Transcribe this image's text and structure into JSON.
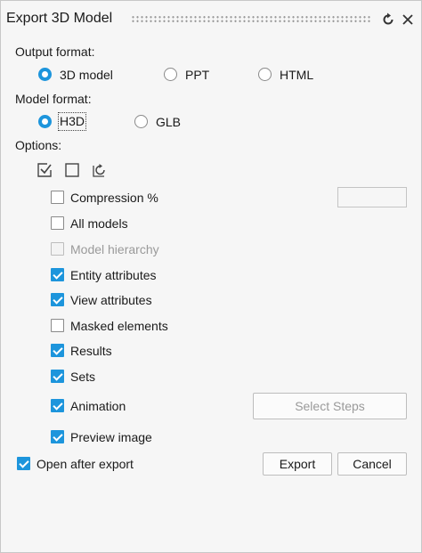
{
  "dialog": {
    "title": "Export 3D Model"
  },
  "output_format": {
    "label": "Output format:",
    "options": [
      {
        "label": "3D model",
        "selected": true
      },
      {
        "label": "PPT",
        "selected": false
      },
      {
        "label": "HTML",
        "selected": false
      }
    ]
  },
  "model_format": {
    "label": "Model format:",
    "options": [
      {
        "label": "H3D",
        "selected": true
      },
      {
        "label": "GLB",
        "selected": false
      }
    ]
  },
  "options": {
    "label": "Options:",
    "compression": {
      "label": "Compression %",
      "checked": false,
      "value": ""
    },
    "all_models": {
      "label": "All models",
      "checked": false
    },
    "model_hierarchy": {
      "label": "Model hierarchy",
      "checked": false,
      "disabled": true
    },
    "entity_attributes": {
      "label": "Entity attributes",
      "checked": true
    },
    "view_attributes": {
      "label": "View attributes",
      "checked": true
    },
    "masked_elements": {
      "label": "Masked elements",
      "checked": false
    },
    "results": {
      "label": "Results",
      "checked": true
    },
    "sets": {
      "label": "Sets",
      "checked": true
    },
    "animation": {
      "label": "Animation",
      "checked": true
    },
    "preview_image": {
      "label": "Preview image",
      "checked": true
    }
  },
  "select_steps_label": "Select Steps",
  "open_after_export": {
    "label": "Open after export",
    "checked": true
  },
  "buttons": {
    "export": "Export",
    "cancel": "Cancel"
  },
  "colors": {
    "accent": "#1d95dc",
    "background": "#f6f6f6"
  },
  "icons": {
    "title_reset": "refresh-icon",
    "title_close": "close-icon",
    "select_all": "check-all-icon",
    "select_none": "uncheck-all-icon",
    "reset_defaults": "reset-icon"
  }
}
